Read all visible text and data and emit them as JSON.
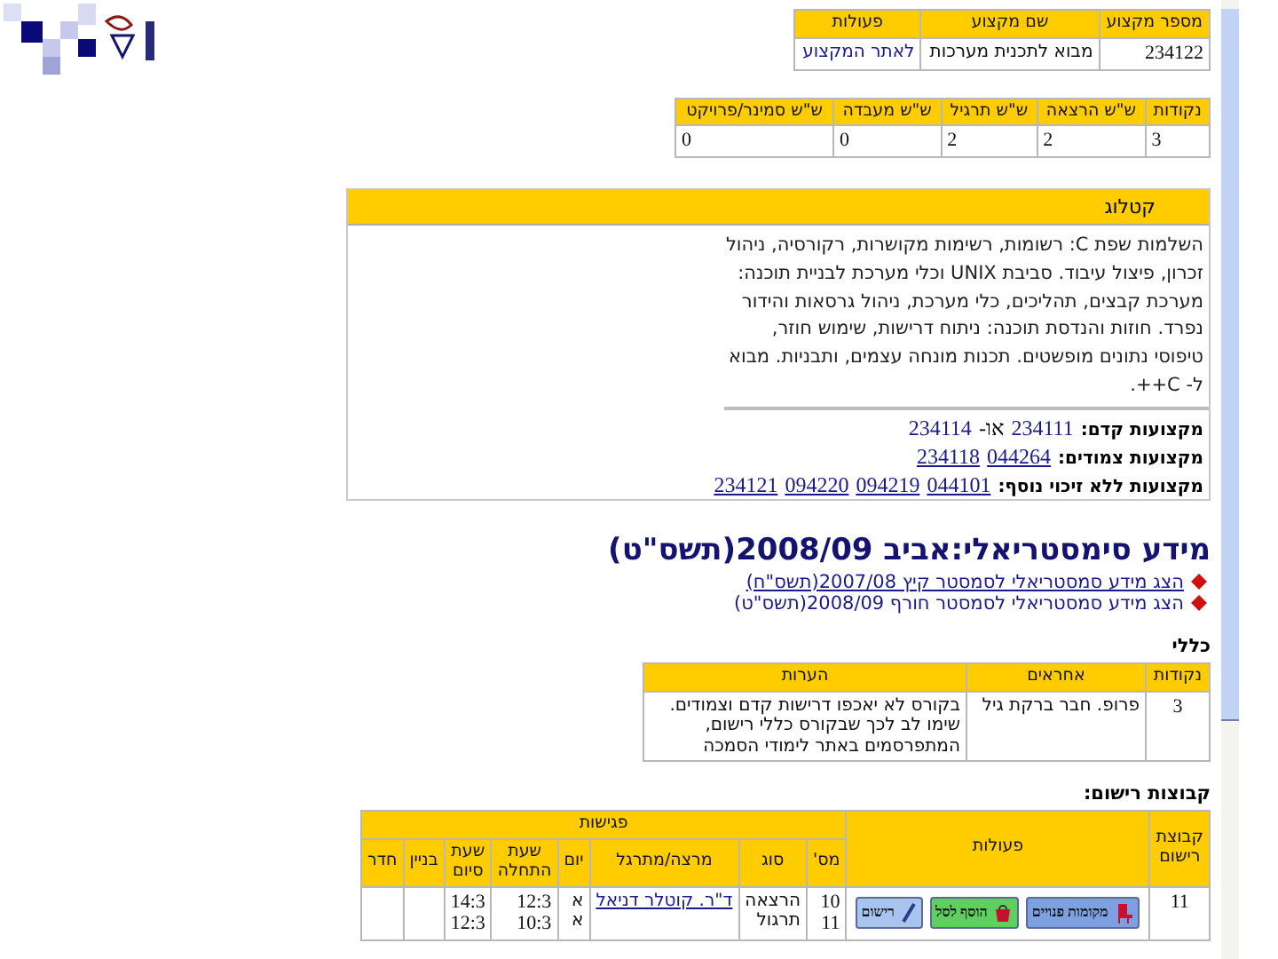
{
  "course_table": {
    "columns": [
      "מספר מקצוע",
      "שם מקצוע",
      "פעולות"
    ],
    "row": {
      "number": "234122",
      "name": "מבוא לתכנית מערכות",
      "link": "לאתר המקצוע"
    }
  },
  "hours_table": {
    "columns": [
      "נקודות",
      "ש\"ש הרצאה",
      "ש\"ש תרגיל",
      "ש\"ש מעבדה",
      "ש\"ש סמינר/פרויקט"
    ],
    "row": [
      "3",
      "2",
      "2",
      "0",
      "0"
    ]
  },
  "catalog": {
    "title": "קטלוג",
    "description": "השלמות שפת C: רשומות, רשימות מקושרות, רקורסיה, ניהול זכרון, פיצול עיבוד. סביבת UNIX וכלי מערכת לבניית תוכנה: מערכת קבצים, תהליכים, כלי מערכת, ניהול גרסאות והידור נפרד. חוזות והנדסת תוכנה: ניתוח דרישות, שימוש חוזר, טיפוסי נתונים מופשטים. תכנות מונחה עצמים, ותבניות. מבוא ל- C++.",
    "relations": [
      {
        "label": "מקצועות קדם:",
        "parts": [
          {
            "kind": "link",
            "text": "234111"
          },
          {
            "kind": "text",
            "text": "או-"
          },
          {
            "kind": "link",
            "text": "234114"
          }
        ]
      },
      {
        "label": "מקצועות צמודים:",
        "parts": [
          {
            "kind": "link",
            "text": "044264"
          },
          {
            "kind": "link",
            "text": "234118"
          }
        ]
      },
      {
        "label": "מקצועות ללא זיכוי נוסף:",
        "parts": [
          {
            "kind": "link",
            "text": "044101"
          },
          {
            "kind": "link",
            "text": "094219"
          },
          {
            "kind": "link",
            "text": "094220"
          },
          {
            "kind": "link",
            "text": "234121"
          }
        ]
      }
    ]
  },
  "semester": {
    "title": "מידע סימסטריאלי:אביב 2008/09(תשס\"ט)",
    "links": [
      {
        "text": "הצג מידע סמסטריאלי לסמסטר קיץ 2007/08(תשס\"ח)",
        "underlined": true
      },
      {
        "text": "הצג מידע סמסטריאלי לסמסטר חורף 2008/09(תשס\"ט)",
        "underlined": false
      }
    ]
  },
  "general": {
    "label": "כללי",
    "columns": [
      "נקודות",
      "אחראים",
      "הערות"
    ],
    "row": [
      "3",
      "פרופ. חבר ברקת גיל",
      "בקורס לא יאכפו דרישות קדם וצמודים. שימו לב לכך שבקורס כללי רישום, המתפרסמים באתר לימודי הסמכה"
    ]
  },
  "groups": {
    "label": "קבוצות רישום:",
    "columns": [
      "קבוצת רישום",
      "פעולות",
      "פגישות"
    ],
    "meeting_columns": [
      "מס'",
      "סוג",
      "מרצה/מתרגל",
      "יום",
      "שעת התחלה",
      "שעת סיום",
      "בניין",
      "חדר"
    ],
    "row": {
      "group": "11",
      "actions": [
        {
          "kind": "seats",
          "text": "מקומות פנויים"
        },
        {
          "kind": "cart",
          "text": "הוסף לסל"
        },
        {
          "kind": "register",
          "text": "רישום"
        }
      ],
      "meetings": [
        {
          "number": "10",
          "type": "הרצאה",
          "lecturer": "ד\"ר. קוטלר דניאל",
          "day": "א",
          "start": "12:3",
          "end": "14:3"
        },
        {
          "number": "11",
          "type": "תרגול",
          "day": "א",
          "start": "10:3",
          "end": "12:3"
        }
      ]
    }
  }
}
